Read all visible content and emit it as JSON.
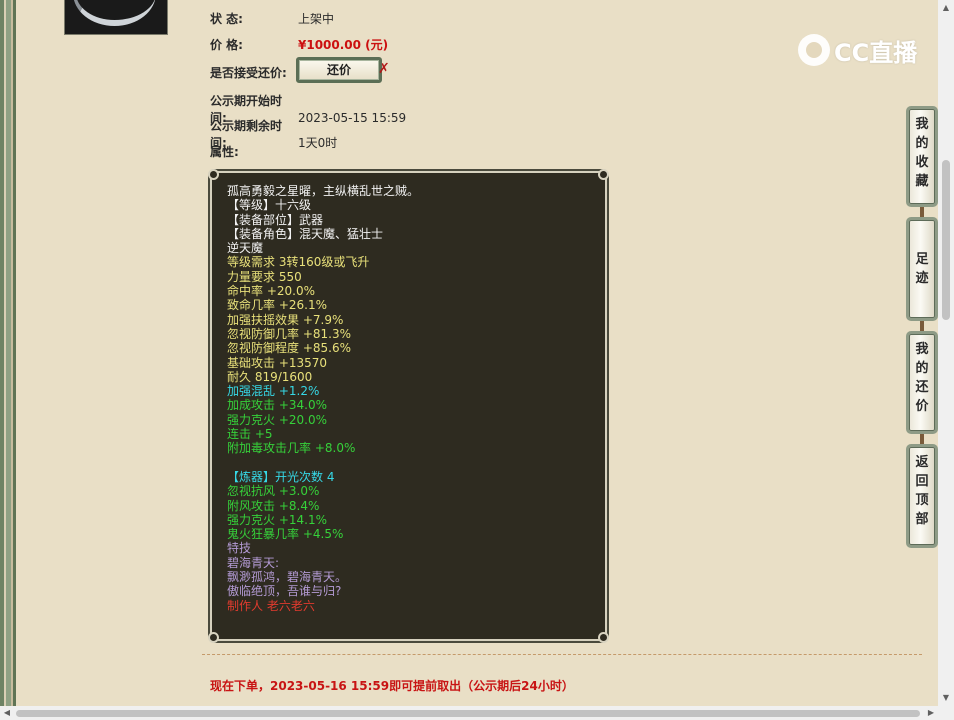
{
  "item": {
    "status_label": "状 态:",
    "status_value": "上架中",
    "price_label": "价 格:",
    "price_value": "¥1000.00 (元)",
    "counter_label": "是否接受还价:",
    "counter_button": "还价",
    "start_label": "公示期开始时间:",
    "start_value": "2023-05-15 15:59",
    "remain_label": "公示期剩余时间:",
    "remain_value": "1天0时",
    "attr_label": "属性:"
  },
  "attributes": [
    {
      "text": "孤高勇毅之星曜，主纵横乱世之贼。",
      "color": "white"
    },
    {
      "text": "【等级】十六级",
      "color": "white"
    },
    {
      "text": "【装备部位】武器",
      "color": "white"
    },
    {
      "text": "【装备角色】混天魔、猛壮士",
      "color": "white"
    },
    {
      "text": "逆天魔",
      "color": "white"
    },
    {
      "text": "等级需求 3转160级或飞升",
      "color": "yellow"
    },
    {
      "text": "力量要求 550",
      "color": "yellow"
    },
    {
      "text": "命中率 +20.0%",
      "color": "yellow"
    },
    {
      "text": "致命几率 +26.1%",
      "color": "yellow"
    },
    {
      "text": "加强扶摇效果 +7.9%",
      "color": "yellow"
    },
    {
      "text": "忽视防御几率 +81.3%",
      "color": "yellow"
    },
    {
      "text": "忽视防御程度 +85.6%",
      "color": "yellow"
    },
    {
      "text": "基础攻击 +13570",
      "color": "yellow"
    },
    {
      "text": "耐久 819/1600",
      "color": "yellow"
    },
    {
      "text": "加强混乱 +1.2%",
      "color": "cyan"
    },
    {
      "text": "加成攻击 +34.0%",
      "color": "green"
    },
    {
      "text": "强力克火 +20.0%",
      "color": "green"
    },
    {
      "text": "连击 +5",
      "color": "green"
    },
    {
      "text": "附加毒攻击几率 +8.0%",
      "color": "green"
    },
    {
      "text": "",
      "color": "white"
    },
    {
      "text": "【炼器】开光次数 4",
      "color": "cyan"
    },
    {
      "text": "忽视抗风 +3.0%",
      "color": "green"
    },
    {
      "text": "附风攻击 +8.4%",
      "color": "green"
    },
    {
      "text": "强力克火 +14.1%",
      "color": "green"
    },
    {
      "text": "鬼火狂暴几率 +4.5%",
      "color": "green"
    },
    {
      "text": "特技",
      "color": "purple"
    },
    {
      "text": "碧海青天:",
      "color": "purple"
    },
    {
      "text": "飘渺孤鸿，碧海青天。",
      "color": "purple"
    },
    {
      "text": "傲临绝顶，吾谁与归?",
      "color": "purple"
    },
    {
      "text": "制作人 老六老六",
      "color": "red"
    }
  ],
  "notice": "现在下单，2023-05-16 15:59即可提前取出（公示期后24小时）",
  "watermark": "CC直播",
  "side_buttons": [
    {
      "label": "我的收藏",
      "chars": [
        "我",
        "的",
        "收",
        "藏"
      ]
    },
    {
      "label": "足迹",
      "chars": [
        "足",
        "迹"
      ]
    },
    {
      "label": "我的还价",
      "chars": [
        "我",
        "的",
        "还",
        "价"
      ]
    },
    {
      "label": "返回顶部",
      "chars": [
        "返",
        "回",
        "顶",
        "部"
      ]
    }
  ],
  "colors": {
    "white": "#f2f2f2",
    "yellow": "#e8e07a",
    "green": "#36d13a",
    "cyan": "#36d8e6",
    "purple": "#b39ad4",
    "red": "#e23b2e",
    "price": "#cc1010"
  }
}
